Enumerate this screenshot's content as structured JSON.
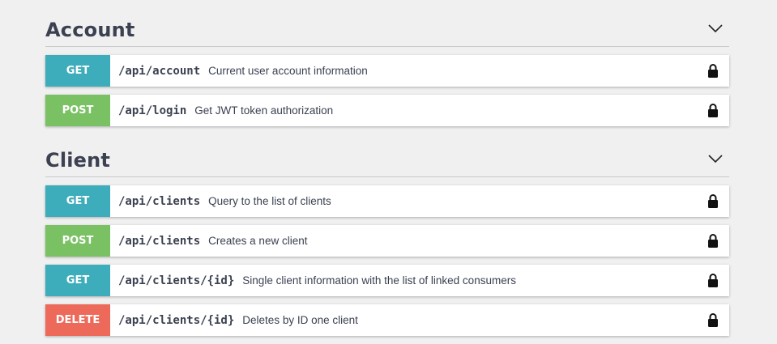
{
  "sections": [
    {
      "title": "Account",
      "endpoints": [
        {
          "method": "GET",
          "path": "/api/account",
          "description": "Current user account information"
        },
        {
          "method": "POST",
          "path": "/api/login",
          "description": "Get JWT token authorization"
        }
      ]
    },
    {
      "title": "Client",
      "endpoints": [
        {
          "method": "GET",
          "path": "/api/clients",
          "description": "Query to the list of clients"
        },
        {
          "method": "POST",
          "path": "/api/clients",
          "description": "Creates a new client"
        },
        {
          "method": "GET",
          "path": "/api/clients/{id}",
          "description": "Single client information with the list of linked consumers"
        },
        {
          "method": "DELETE",
          "path": "/api/clients/{id}",
          "description": "Deletes by ID one client"
        }
      ]
    }
  ],
  "colors": {
    "get": "#3eadbb",
    "post": "#79c163",
    "delete": "#ed6a5b",
    "text": "#3b4151",
    "background": "#f0f0f0"
  },
  "icons": {
    "collapse": "chevron-down-icon",
    "auth": "lock-icon"
  }
}
